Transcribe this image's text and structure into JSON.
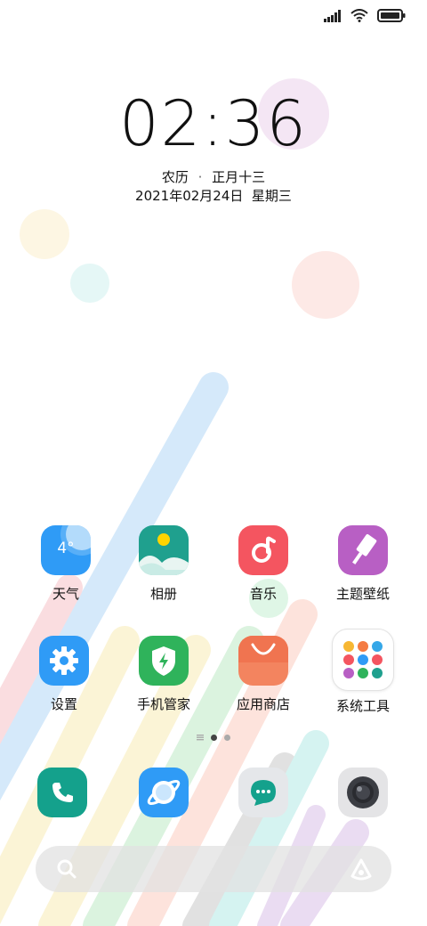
{
  "status_bar": {
    "icons": [
      "signal-icon",
      "wifi-icon",
      "battery-icon"
    ]
  },
  "clock": {
    "time": "02:36"
  },
  "lunar": {
    "label": "农历",
    "separator": "·",
    "day": "正月十三"
  },
  "date": {
    "text": "2021年02月24日  星期三"
  },
  "apps": [
    {
      "id": "weather",
      "label": "天气",
      "icon": "weather-icon",
      "temp": "4°",
      "color": "#2f9bf6"
    },
    {
      "id": "gallery",
      "label": "相册",
      "icon": "gallery-icon",
      "color": "#1fa08e"
    },
    {
      "id": "music",
      "label": "音乐",
      "icon": "music-icon",
      "color": "#f45560"
    },
    {
      "id": "themes",
      "label": "主题壁纸",
      "icon": "paint-roller-icon",
      "color": "#b85fc4"
    },
    {
      "id": "settings",
      "label": "设置",
      "icon": "gear-icon",
      "color": "#2f9bf6"
    },
    {
      "id": "security",
      "label": "手机管家",
      "icon": "shield-icon",
      "color": "#2fb35b"
    },
    {
      "id": "appstore",
      "label": "应用商店",
      "icon": "shopping-bag-icon",
      "color": "#f3845f"
    },
    {
      "id": "tools",
      "label": "系统工具",
      "icon": "folder-icon",
      "color": "#ffffff"
    }
  ],
  "page_indicator": {
    "pages": 3,
    "current": 1
  },
  "dock": [
    {
      "id": "phone",
      "icon": "phone-icon",
      "color": "#14a18c"
    },
    {
      "id": "browser",
      "icon": "browser-icon",
      "color": "#2f9bf6"
    },
    {
      "id": "messages",
      "icon": "message-icon",
      "color": "#e5e7ea"
    },
    {
      "id": "camera",
      "icon": "camera-icon",
      "color": "#e4e4e6"
    }
  ],
  "search_bar": {
    "left_icon": "search-icon",
    "right_icon": "assistant-icon"
  }
}
